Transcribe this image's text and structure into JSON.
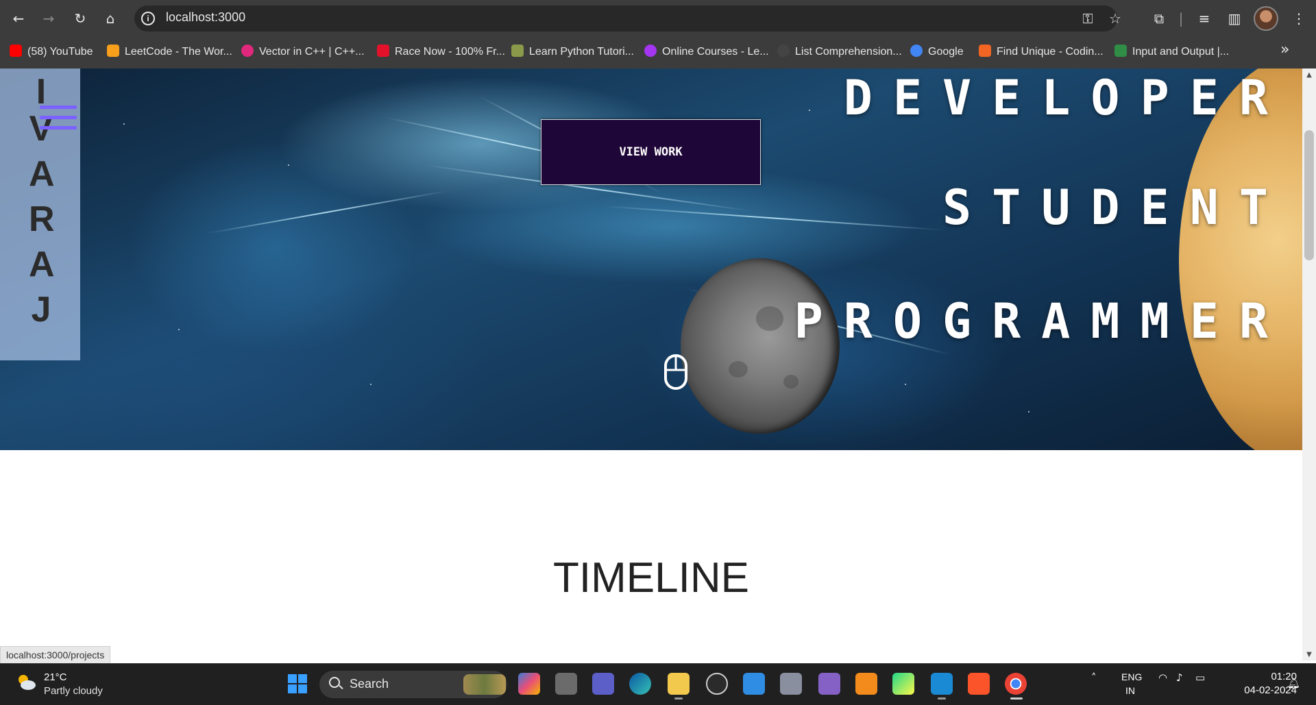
{
  "browser": {
    "url": "localhost:3000",
    "status_url": "localhost:3000/projects"
  },
  "bookmarks": [
    {
      "label": "(58) YouTube",
      "color": "#ff0000"
    },
    {
      "label": "LeetCode - The Wor...",
      "color": "#f89f1b"
    },
    {
      "label": "Vector in C++ | C++...",
      "color": "#e0287d"
    },
    {
      "label": "Race Now - 100% Fr...",
      "color": "#e3122a"
    },
    {
      "label": "Learn Python Tutori...",
      "color": "#8b9a4a"
    },
    {
      "label": "Online Courses - Le...",
      "color": "#a435f0"
    },
    {
      "label": "List Comprehension...",
      "color": "#444444"
    },
    {
      "label": "Google",
      "color": "#4285f4"
    },
    {
      "label": "Find Unique - Codin...",
      "color": "#f26522"
    },
    {
      "label": "Input and Output |...",
      "color": "#2f8d46"
    }
  ],
  "page": {
    "sidebar_letters": [
      "I",
      "V",
      "A",
      "R",
      "A",
      "J"
    ],
    "view_work_label": "VIEW WORK",
    "hero_words": [
      "DEVELOPER",
      "STUDENT",
      "PROGRAMMER"
    ],
    "section_title": "TIMELINE"
  },
  "taskbar": {
    "weather_temp": "21°C",
    "weather_desc": "Partly cloudy",
    "search_label": "Search",
    "lang_top": "ENG",
    "lang_bottom": "IN",
    "time": "01:20",
    "date": "04-02-2024"
  },
  "colors": {
    "accent_purple": "#7b61ff",
    "button_bg": "#1f0638"
  }
}
